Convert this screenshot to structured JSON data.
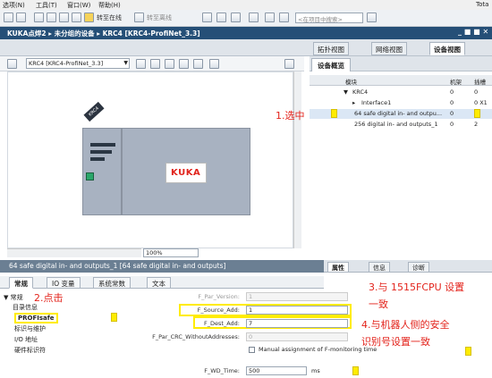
{
  "menubar": {
    "items": [
      "选项(N)",
      "工具(T)",
      "窗口(W)",
      "帮助(H)"
    ],
    "brand": "Tota"
  },
  "toolbar": {
    "go_online": "转至在线",
    "go_offline": "转至离线",
    "search_placeholder": "<在项目中搜索>"
  },
  "titlebar": {
    "breadcrumb": "KUKA点焊2 ▸ 未分组的设备 ▸ KRC4 [KRC4-ProfiNet_3.3]",
    "controls": "_ ■ ■ ✕"
  },
  "view_tabs": {
    "topology": "拓扑视图",
    "network": "网络视图",
    "device": "设备视图"
  },
  "device_toolbar": {
    "device_select": "KRC4 [KRC4-ProfiNet_3.3]"
  },
  "canvas": {
    "device_tag": "KRC4",
    "logo": "KUKA",
    "zoom": "100%"
  },
  "overview": {
    "tab_label": "设备概览",
    "headers": {
      "module": "模块",
      "rack": "机架",
      "slot": "插槽"
    },
    "rows": [
      {
        "name": "KRC4",
        "rack": "0",
        "slot": "0"
      },
      {
        "name": "Interface1",
        "rack": "0",
        "slot": "0 X1"
      },
      {
        "name": "64 safe digital in- and outpu...",
        "rack": "0",
        "slot": "1"
      },
      {
        "name": "256 digital in- and outputs_1",
        "rack": "0",
        "slot": "2"
      }
    ]
  },
  "annotations": {
    "a1": "1.选中",
    "a2": "2.点击",
    "a3": "3.与 1515FCPU 设置",
    "a3b": "一致",
    "a4": "4.与机器人侧的安全",
    "a4b": "识别号设置一致"
  },
  "properties": {
    "title": "64 safe digital in- and outputs_1 [64 safe digital in- and outputs]",
    "tabs": {
      "properties": "属性",
      "info": "信息",
      "diagnostics": "诊断"
    },
    "subtabs": {
      "general": "常规",
      "io_vars": "IO 变量",
      "sys_const": "系统常数",
      "text": "文本"
    },
    "nav": {
      "general": "常规",
      "catalog": "目录信息",
      "profisafe": "PROFIsafe",
      "id_maint": "标识与维护",
      "io_addr": "I/O 地址",
      "hw_id": "硬件标识符"
    },
    "fields": {
      "f_par_version_label": "F_Par_Version:",
      "f_par_version_value": "1",
      "f_source_label": "F_Source_Add:",
      "f_source_value": "1",
      "f_dest_label": "F_Dest_Add:",
      "f_dest_value": "7",
      "f_crc_label": "F_Par_CRC_WithoutAddresses:",
      "f_crc_value": "0",
      "manual_label": "Manual assignment of F-monitoring time",
      "f_wd_label": "F_WD_Time:",
      "f_wd_value": "500",
      "f_wd_unit": "ms"
    }
  }
}
